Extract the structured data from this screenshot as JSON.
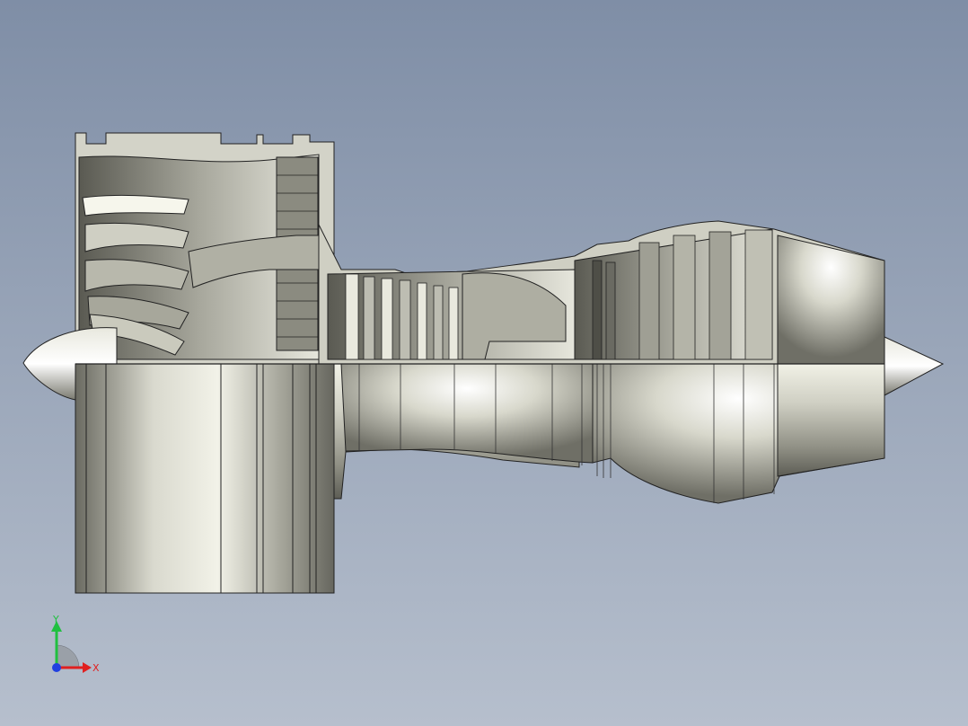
{
  "viewport": {
    "background_top": "#7f8ea6",
    "background_bottom": "#b6bfcd"
  },
  "model": {
    "name": "turbofan-engine-cutaway",
    "body_color": "#c9c9bd",
    "shadow_color": "#6e6e64",
    "highlight_color": "#f4f4ea",
    "edge_color": "#222222"
  },
  "triad": {
    "x_label": "X",
    "y_label": "Y",
    "x_color": "#e02020",
    "y_color": "#20c040",
    "z_color": "#2040e0"
  }
}
